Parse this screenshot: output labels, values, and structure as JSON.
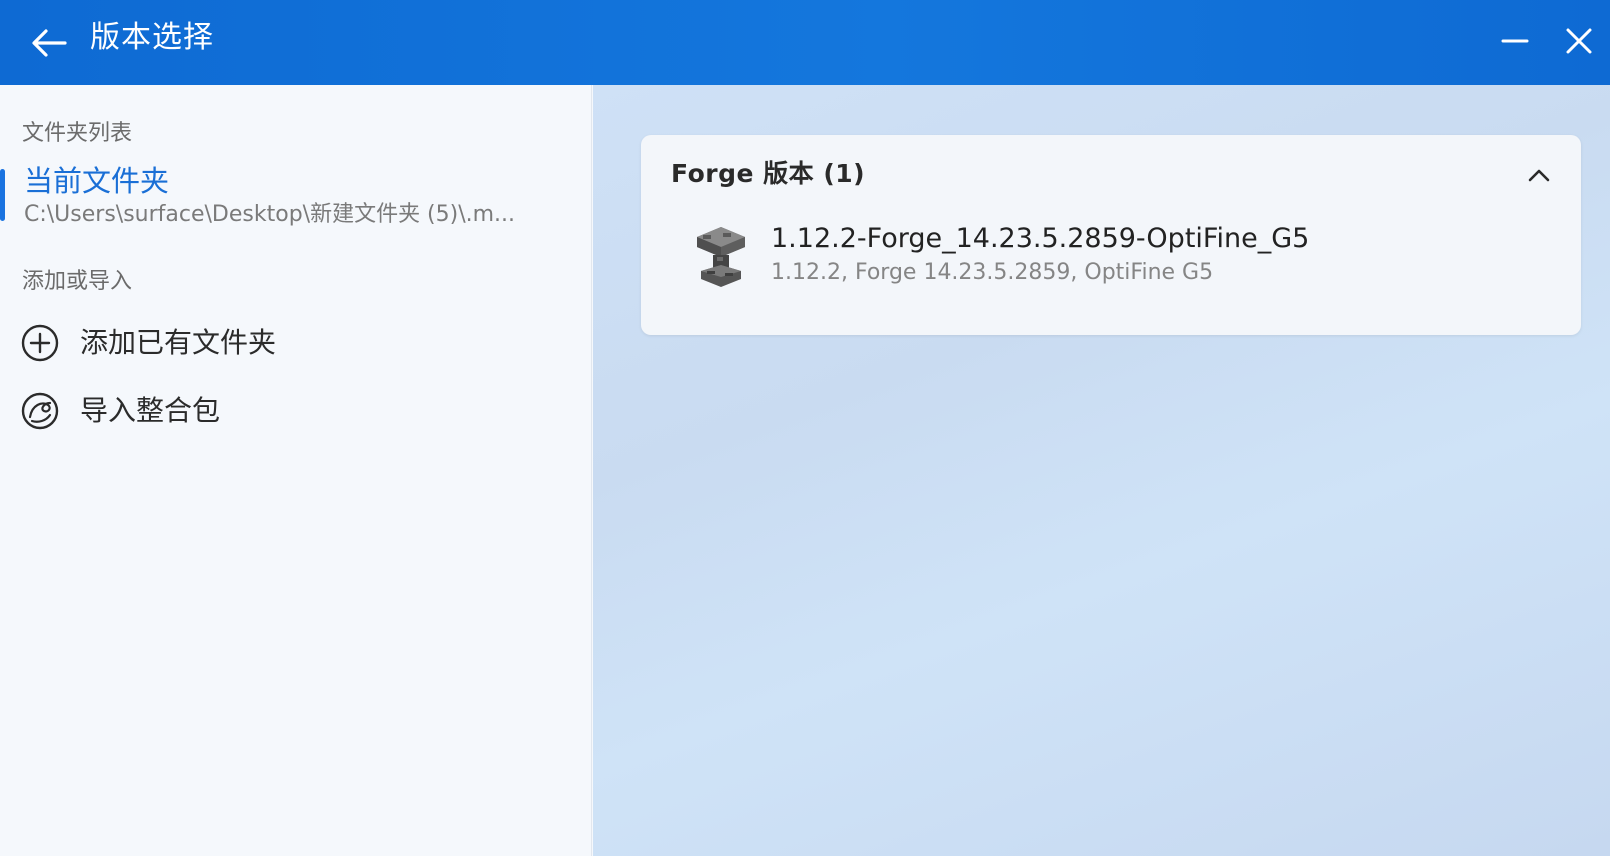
{
  "window": {
    "title": "版本选择",
    "accent": "#1a6fd6",
    "titlebar_color": "#1172da"
  },
  "sidebar": {
    "folder_list_label": "文件夹列表",
    "current_folder": {
      "name": "当前文件夹",
      "path": "C:\\Users\\surface\\Desktop\\新建文件夹 (5)\\.m..."
    },
    "add_import_label": "添加或导入",
    "actions": [
      {
        "label": "添加已有文件夹",
        "icon": "add-circle-icon"
      },
      {
        "label": "导入整合包",
        "icon": "modpack-import-icon"
      }
    ]
  },
  "main": {
    "group": {
      "title": "Forge 版本 (1)",
      "collapse_icon": "chevron-up-icon",
      "versions": [
        {
          "name": "1.12.2-Forge_14.23.5.2859-OptiFine_G5",
          "description": "1.12.2, Forge 14.23.5.2859, OptiFine G5",
          "icon": "anvil-block-icon"
        }
      ]
    }
  }
}
